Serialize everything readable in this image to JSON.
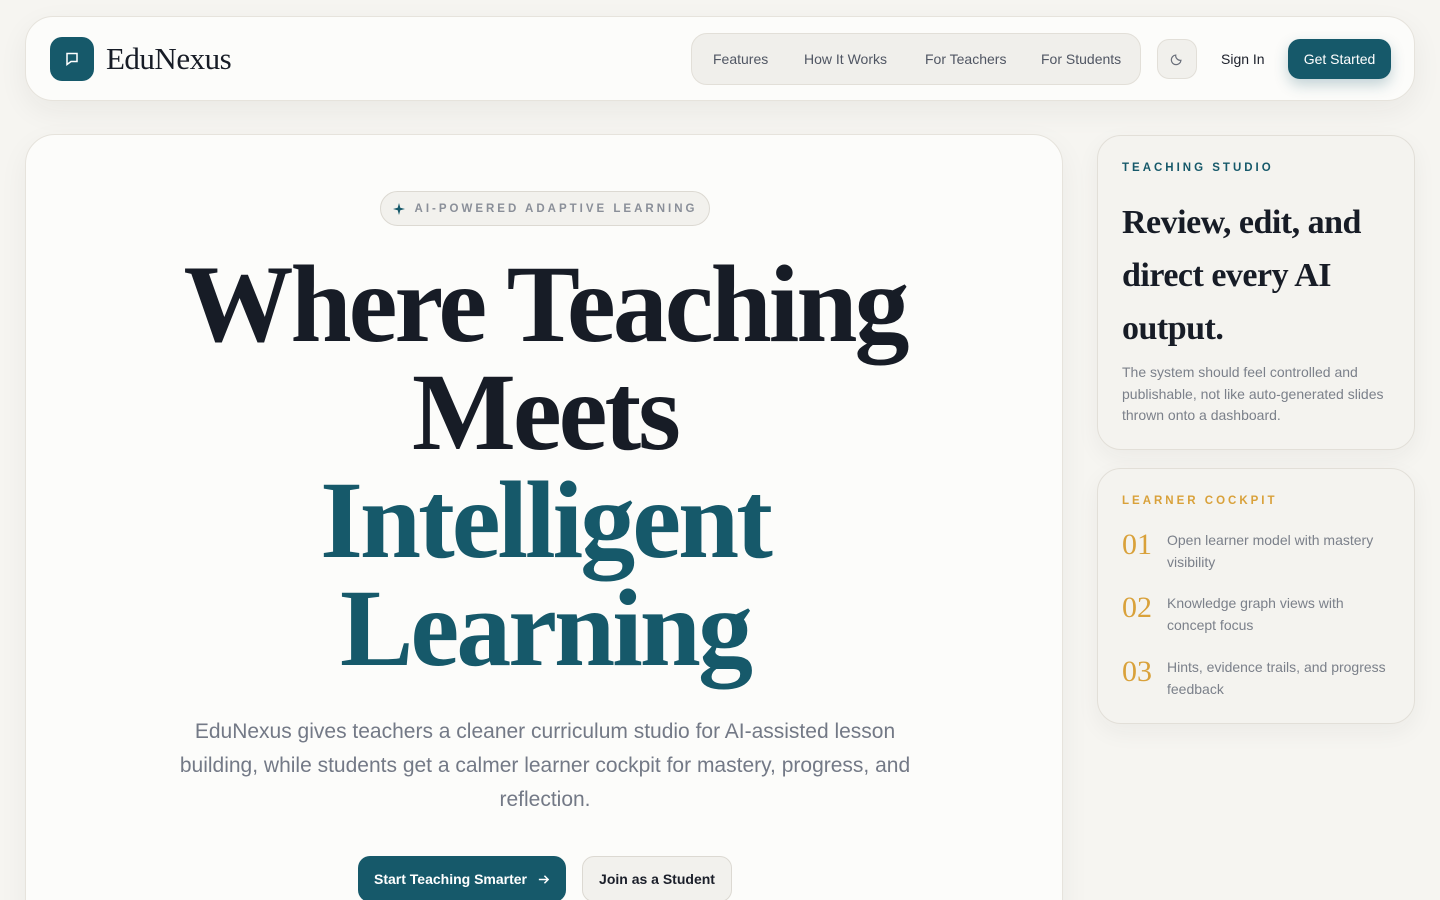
{
  "header": {
    "brand": "EduNexus",
    "nav": [
      "Features",
      "How It Works",
      "For Teachers",
      "For Students"
    ],
    "theme_icon": "moon-icon",
    "sign_in": "Sign In",
    "get_started": "Get Started"
  },
  "hero": {
    "eyebrow": "AI-POWERED ADAPTIVE LEARNING",
    "headline_line1": "Where Teaching",
    "headline_line2": "Meets",
    "headline_line3": "Intelligent",
    "headline_line4": "Learning",
    "subcopy": "EduNexus gives teachers a cleaner curriculum studio for AI-assisted lesson building, while students get a calmer learner cockpit for mastery, progress, and reflection.",
    "cta_primary": "Start Teaching Smarter",
    "cta_secondary": "Join as a Student"
  },
  "teaching_studio": {
    "eyebrow": "TEACHING STUDIO",
    "title": "Review, edit, and direct every AI output.",
    "body": "The system should feel controlled and publishable, not like auto-generated slides thrown onto a dashboard."
  },
  "learner_cockpit": {
    "eyebrow": "LEARNER COCKPIT",
    "steps": [
      {
        "num": "01",
        "text": "Open learner model with mastery visibility"
      },
      {
        "num": "02",
        "text": "Knowledge graph views with concept focus"
      },
      {
        "num": "03",
        "text": "Hints, evidence trails, and progress feedback"
      }
    ]
  },
  "colors": {
    "accent": "#16596a",
    "gold": "#d9a13a",
    "background": "#f6f5f1"
  }
}
